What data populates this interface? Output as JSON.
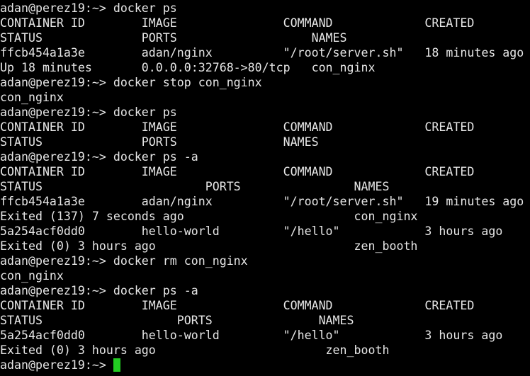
{
  "terminal": {
    "prompt": "adan@perez19:~> ",
    "cursor_color": "#22cc22",
    "lines": [
      "adan@perez19:~> docker ps",
      "CONTAINER ID        IMAGE               COMMAND             CREATED",
      "STATUS              PORTS                   NAMES",
      "ffcb454a1a3e        adan/nginx          \"/root/server.sh\"   18 minutes ago",
      "Up 18 minutes       0.0.0.0:32768->80/tcp   con_nginx",
      "adan@perez19:~> docker stop con_nginx",
      "con_nginx",
      "adan@perez19:~> docker ps",
      "CONTAINER ID        IMAGE               COMMAND             CREATED",
      "STATUS              PORTS               NAMES",
      "adan@perez19:~> docker ps -a",
      "CONTAINER ID        IMAGE               COMMAND             CREATED",
      "STATUS                       PORTS                NAMES",
      "ffcb454a1a3e        adan/nginx          \"/root/server.sh\"   19 minutes ago",
      "Exited (137) 7 seconds ago                        con_nginx",
      "5a254acf0dd0        hello-world         \"/hello\"            3 hours ago",
      "Exited (0) 3 hours ago                            zen_booth",
      "adan@perez19:~> docker rm con_nginx",
      "con_nginx",
      "adan@perez19:~> docker ps -a",
      "CONTAINER ID        IMAGE               COMMAND             CREATED",
      "STATUS                   PORTS               NAMES",
      "5a254acf0dd0        hello-world         \"/hello\"            3 hours ago",
      "Exited (0) 3 hours ago                        zen_booth"
    ]
  }
}
